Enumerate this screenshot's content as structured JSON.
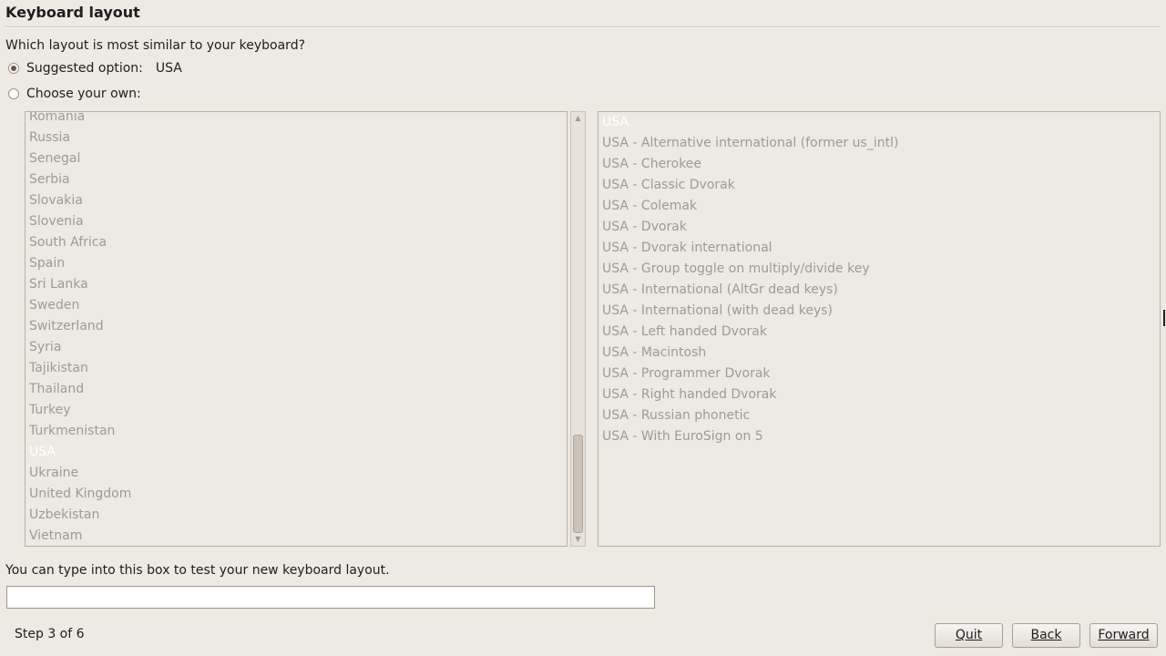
{
  "page": {
    "title": "Keyboard layout",
    "question": "Which layout is most similar to your keyboard?"
  },
  "options": {
    "suggested_label": "Suggested option:",
    "suggested_value": "USA",
    "choose_label": "Choose your own:"
  },
  "countries": [
    {
      "label": "Romania"
    },
    {
      "label": "Russia"
    },
    {
      "label": "Senegal"
    },
    {
      "label": "Serbia"
    },
    {
      "label": "Slovakia"
    },
    {
      "label": "Slovenia"
    },
    {
      "label": "South Africa"
    },
    {
      "label": "Spain"
    },
    {
      "label": "Sri Lanka"
    },
    {
      "label": "Sweden"
    },
    {
      "label": "Switzerland"
    },
    {
      "label": "Syria"
    },
    {
      "label": "Tajikistan"
    },
    {
      "label": "Thailand"
    },
    {
      "label": "Turkey"
    },
    {
      "label": "Turkmenistan"
    },
    {
      "label": "USA",
      "selected": true
    },
    {
      "label": "Ukraine"
    },
    {
      "label": "United Kingdom"
    },
    {
      "label": "Uzbekistan"
    },
    {
      "label": "Vietnam"
    }
  ],
  "variants": [
    {
      "label": "USA",
      "selected": true
    },
    {
      "label": "USA - Alternative international (former us_intl)"
    },
    {
      "label": "USA - Cherokee"
    },
    {
      "label": "USA - Classic Dvorak"
    },
    {
      "label": "USA - Colemak"
    },
    {
      "label": "USA - Dvorak"
    },
    {
      "label": "USA - Dvorak international"
    },
    {
      "label": "USA - Group toggle on multiply/divide key"
    },
    {
      "label": "USA - International (AltGr dead keys)"
    },
    {
      "label": "USA - International (with dead keys)"
    },
    {
      "label": "USA - Left handed Dvorak"
    },
    {
      "label": "USA - Macintosh"
    },
    {
      "label": "USA - Programmer Dvorak"
    },
    {
      "label": "USA - Right handed Dvorak"
    },
    {
      "label": "USA - Russian phonetic"
    },
    {
      "label": "USA - With EuroSign on 5"
    }
  ],
  "test": {
    "label": "You can type into this box to test your new keyboard layout.",
    "value": ""
  },
  "footer": {
    "step": "Step 3 of 6",
    "quit": "Quit",
    "back": "Back",
    "forward": "Forward"
  },
  "icons": {
    "scroll_up": "scroll-up-arrow",
    "scroll_down": "scroll-down-arrow"
  },
  "colors": {
    "background": "#ede9e3",
    "list_text": "#9b9b9b",
    "selected_text": "#ffffff",
    "radio_dot": "#6a5547"
  }
}
